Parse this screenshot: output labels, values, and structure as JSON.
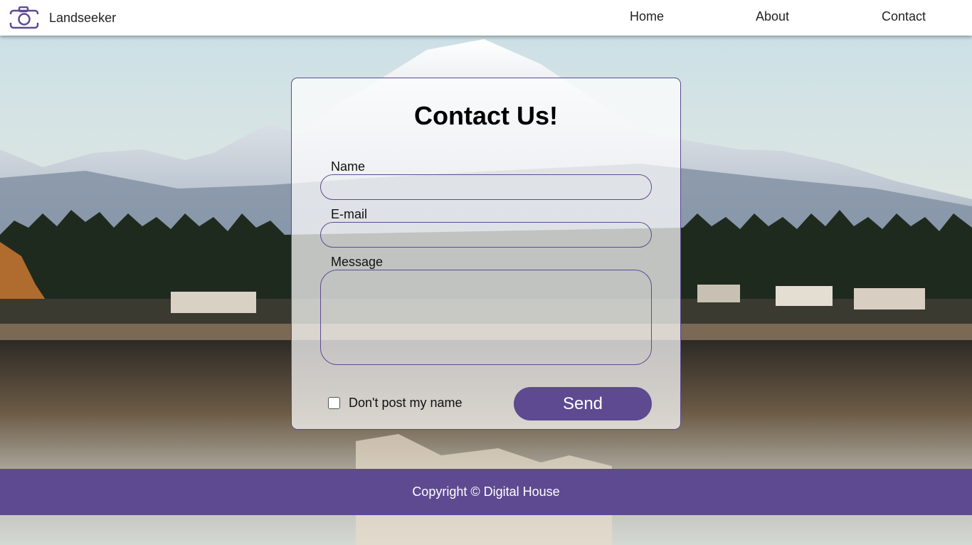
{
  "header": {
    "brand_name": "Landseeker",
    "logo_icon": "camera-icon",
    "nav": [
      {
        "label": "Home"
      },
      {
        "label": "About"
      },
      {
        "label": "Contact"
      }
    ]
  },
  "contact_form": {
    "title": "Contact Us!",
    "name_label": "Name",
    "name_value": "",
    "email_label": "E-mail",
    "email_value": "",
    "message_label": "Message",
    "message_value": "",
    "checkbox_label": "Don't post my name",
    "checkbox_checked": false,
    "send_label": "Send"
  },
  "footer": {
    "copyright": "Copyright © Digital House"
  },
  "colors": {
    "accent": "#5e4a91",
    "header_bg": "#ffffff",
    "footer_text": "#ffffff"
  }
}
